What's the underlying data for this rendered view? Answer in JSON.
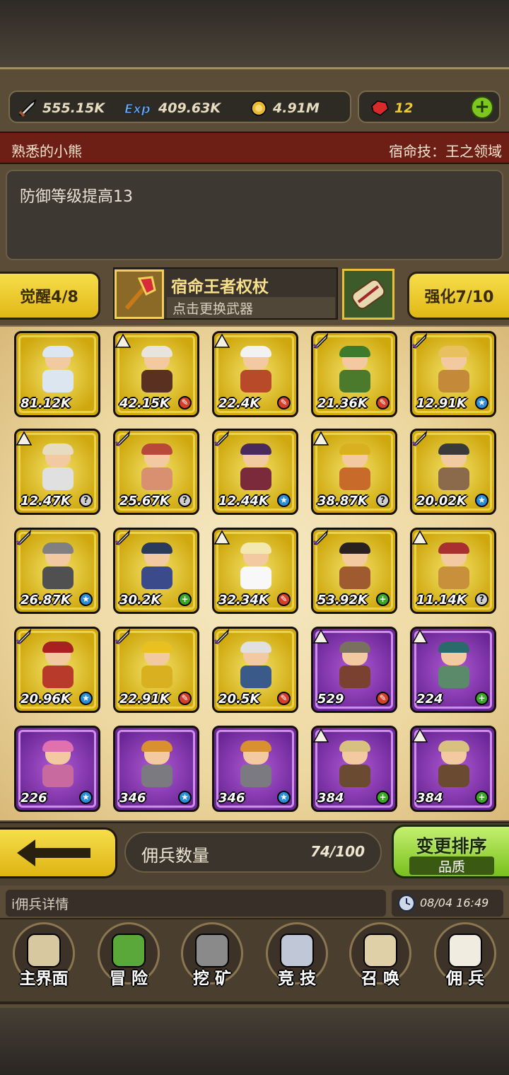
{
  "resources": {
    "attack": "555.15K",
    "exp": "409.63K",
    "gold": "4.91M",
    "gems": "12"
  },
  "hero": {
    "name": "熟悉的小熊",
    "fate_skill": "宿命技：王之领域",
    "description": "防御等级提高13"
  },
  "awaken": "觉醒4/8",
  "upgrade": "强化7/10",
  "weapon": {
    "name": "宿命王者权杖",
    "hint": "点击更换武器"
  },
  "mercs": [
    {
      "level": "81.12K",
      "badge": "",
      "rarity": "gold",
      "tag": "",
      "hair": "#dbe6f0",
      "body": "#dbe6f0"
    },
    {
      "level": "42.15K",
      "badge": "red",
      "rarity": "gold",
      "tag": "tent",
      "hair": "#e8e4dc",
      "body": "#5a3020"
    },
    {
      "level": "22.4K",
      "badge": "red",
      "rarity": "gold",
      "tag": "tent",
      "hair": "#f2f2f2",
      "body": "#b84a2a"
    },
    {
      "level": "21.36K",
      "badge": "red",
      "rarity": "gold",
      "tag": "sword",
      "hair": "#3e7a2c",
      "body": "#4c7a2c"
    },
    {
      "level": "12.91K",
      "badge": "blue",
      "rarity": "gold",
      "tag": "sword",
      "hair": "#e8c060",
      "body": "#c48a3a"
    },
    {
      "level": "12.47K",
      "badge": "gray",
      "rarity": "gold",
      "tag": "tent",
      "hair": "#e8dcc0",
      "body": "#e0e0e0"
    },
    {
      "level": "25.67K",
      "badge": "gray",
      "rarity": "gold",
      "tag": "sword",
      "hair": "#b8483a",
      "body": "#d89070"
    },
    {
      "level": "12.44K",
      "badge": "blue",
      "rarity": "gold",
      "tag": "sword",
      "hair": "#4a2a5a",
      "body": "#7a2a3a"
    },
    {
      "level": "38.87K",
      "badge": "gray",
      "rarity": "gold",
      "tag": "tent",
      "hair": "#d8b020",
      "body": "#c86a2a"
    },
    {
      "level": "20.02K",
      "badge": "blue",
      "rarity": "gold",
      "tag": "sword",
      "hair": "#3a3a3a",
      "body": "#8a6a4a"
    },
    {
      "level": "26.87K",
      "badge": "blue",
      "rarity": "gold",
      "tag": "sword",
      "hair": "#808080",
      "body": "#505050"
    },
    {
      "level": "30.2K",
      "badge": "green",
      "rarity": "gold",
      "tag": "sword",
      "hair": "#2a3a5a",
      "body": "#3a4a8a"
    },
    {
      "level": "32.34K",
      "badge": "red",
      "rarity": "gold",
      "tag": "tent",
      "hair": "#f2e8b0",
      "body": "#f8f8f8"
    },
    {
      "level": "53.92K",
      "badge": "green",
      "rarity": "gold",
      "tag": "sword",
      "hair": "#2a2020",
      "body": "#a05a30"
    },
    {
      "level": "11.14K",
      "badge": "gray",
      "rarity": "gold",
      "tag": "tent",
      "hair": "#a83030",
      "body": "#c8903a"
    },
    {
      "level": "20.96K",
      "badge": "blue",
      "rarity": "gold",
      "tag": "sword",
      "hair": "#a82020",
      "body": "#b83a2a"
    },
    {
      "level": "22.91K",
      "badge": "red",
      "rarity": "gold",
      "tag": "sword",
      "hair": "#e8c020",
      "body": "#d8b020"
    },
    {
      "level": "20.5K",
      "badge": "red",
      "rarity": "gold",
      "tag": "sword",
      "hair": "#e0e0e0",
      "body": "#3a5a8a"
    },
    {
      "level": "529",
      "badge": "red",
      "rarity": "purple",
      "tag": "tent",
      "hair": "#7a7060",
      "body": "#7a4030"
    },
    {
      "level": "224",
      "badge": "green",
      "rarity": "purple",
      "tag": "tent",
      "hair": "#2a6a6a",
      "body": "#5a8a6a"
    },
    {
      "level": "226",
      "badge": "blue",
      "rarity": "purple",
      "tag": "",
      "hair": "#e070b0",
      "body": "#c86aa0"
    },
    {
      "level": "346",
      "badge": "blue",
      "rarity": "purple",
      "tag": "",
      "hair": "#d89030",
      "body": "#7a7a80"
    },
    {
      "level": "346",
      "badge": "blue",
      "rarity": "purple",
      "tag": "",
      "hair": "#d89030",
      "body": "#7a7a80"
    },
    {
      "level": "384",
      "badge": "green",
      "rarity": "purple",
      "tag": "tent",
      "hair": "#d8c080",
      "body": "#6a4a30"
    },
    {
      "level": "384",
      "badge": "green",
      "rarity": "purple",
      "tag": "tent",
      "hair": "#d8c080",
      "body": "#6a4a30"
    }
  ],
  "merc_count_label": "佣兵数量",
  "merc_count": "74/100",
  "sort": {
    "label": "变更排序",
    "mode": "品质"
  },
  "info_label": "i佣兵详情",
  "datetime": "08/04 16:49",
  "nav": [
    {
      "label": "主界面",
      "icon": "map-icon"
    },
    {
      "label": "冒 险",
      "icon": "island-icon"
    },
    {
      "label": "挖 矿",
      "icon": "pickaxe-icon"
    },
    {
      "label": "竞 技",
      "icon": "crossed-swords-icon"
    },
    {
      "label": "召 唤",
      "icon": "scroll-icon"
    },
    {
      "label": "佣 兵",
      "icon": "tent-icon"
    }
  ],
  "colors": {
    "gold_button": "#f7de4a",
    "green_button": "#79c01c",
    "banner": "#6e1f15"
  }
}
